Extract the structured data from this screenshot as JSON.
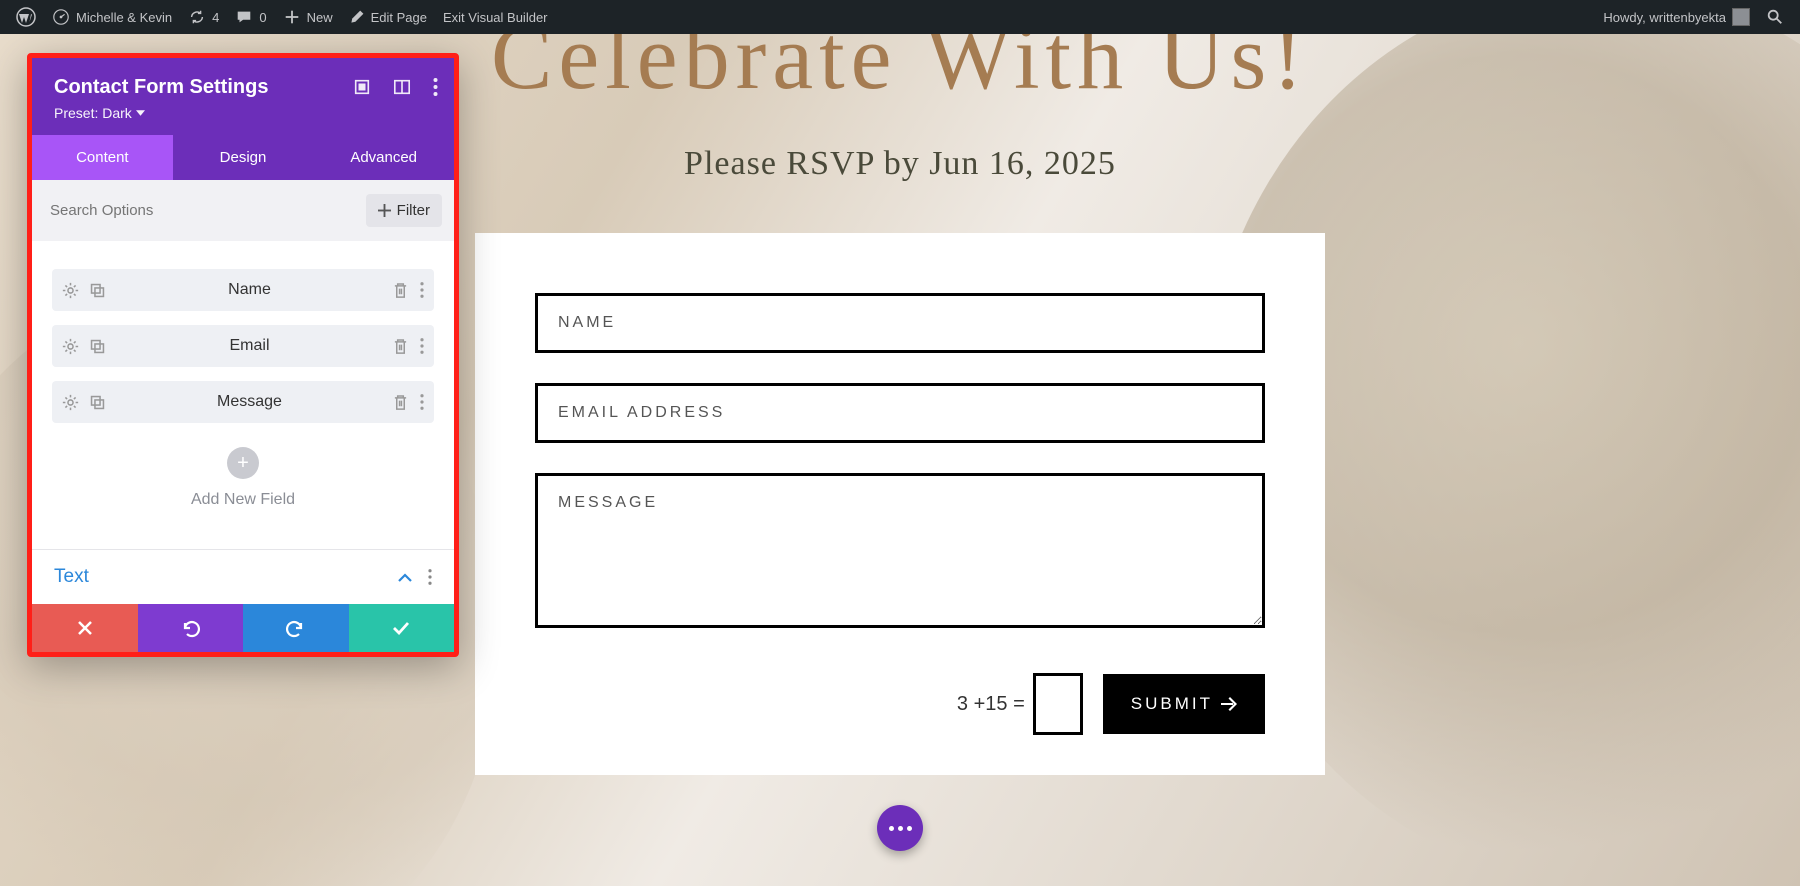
{
  "adminBar": {
    "siteName": "Michelle & Kevin",
    "updates": "4",
    "comments": "0",
    "newLabel": "New",
    "editPage": "Edit Page",
    "exitBuilder": "Exit Visual Builder",
    "howdy": "Howdy, writtenbyekta"
  },
  "page": {
    "heading": "Celebrate With Us!",
    "subheading": "Please RSVP by Jun 16, 2025"
  },
  "form": {
    "namePlaceholder": "NAME",
    "emailPlaceholder": "EMAIL ADDRESS",
    "messagePlaceholder": "MESSAGE",
    "captcha": "3 +15 =",
    "submit": "SUBMIT"
  },
  "modal": {
    "title": "Contact Form Settings",
    "preset": "Preset: Dark",
    "tabs": {
      "content": "Content",
      "design": "Design",
      "advanced": "Advanced"
    },
    "searchPlaceholder": "Search Options",
    "filter": "Filter",
    "fields": [
      {
        "label": "Name"
      },
      {
        "label": "Email"
      },
      {
        "label": "Message"
      }
    ],
    "addField": "Add New Field",
    "textSection": "Text"
  }
}
